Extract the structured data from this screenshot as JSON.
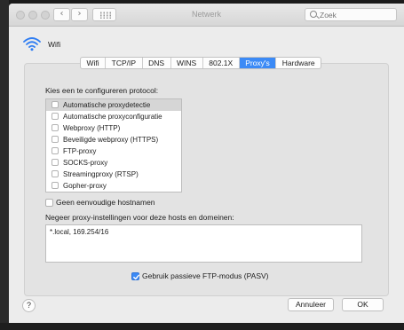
{
  "window": {
    "title": "Netwerk",
    "search_placeholder": "Zoek"
  },
  "service": {
    "name": "Wifi"
  },
  "tabs": [
    {
      "label": "Wifi",
      "active": false
    },
    {
      "label": "TCP/IP",
      "active": false
    },
    {
      "label": "DNS",
      "active": false
    },
    {
      "label": "WINS",
      "active": false
    },
    {
      "label": "802.1X",
      "active": false
    },
    {
      "label": "Proxy's",
      "active": true
    },
    {
      "label": "Hardware",
      "active": false
    }
  ],
  "protocols": {
    "heading": "Kies een te configureren protocol:",
    "items": [
      {
        "label": "Automatische proxydetectie",
        "checked": false,
        "selected": true
      },
      {
        "label": "Automatische proxyconfiguratie",
        "checked": false,
        "selected": false
      },
      {
        "label": "Webproxy (HTTP)",
        "checked": false,
        "selected": false
      },
      {
        "label": "Beveiligde webproxy (HTTPS)",
        "checked": false,
        "selected": false
      },
      {
        "label": "FTP-proxy",
        "checked": false,
        "selected": false
      },
      {
        "label": "SOCKS-proxy",
        "checked": false,
        "selected": false
      },
      {
        "label": "Streamingproxy (RTSP)",
        "checked": false,
        "selected": false
      },
      {
        "label": "Gopher-proxy",
        "checked": false,
        "selected": false
      }
    ]
  },
  "options": {
    "simple_hostnames": {
      "label": "Geen eenvoudige hostnamen",
      "checked": false
    },
    "bypass_label": "Negeer proxy-instellingen voor deze hosts en domeinen:",
    "bypass_value": "*.local, 169.254/16",
    "passive_ftp": {
      "label": "Gebruik passieve FTP-modus (PASV)",
      "checked": true
    }
  },
  "buttons": {
    "help": "?",
    "cancel": "Annuleer",
    "ok": "OK"
  },
  "icons": {
    "wifi": "wifi-icon",
    "search": "search-icon",
    "back": "chevron-left-icon",
    "forward": "chevron-right-icon",
    "show_all": "grid-icon"
  },
  "colors": {
    "accent": "#3b8af6",
    "window_bg": "#ececec"
  }
}
